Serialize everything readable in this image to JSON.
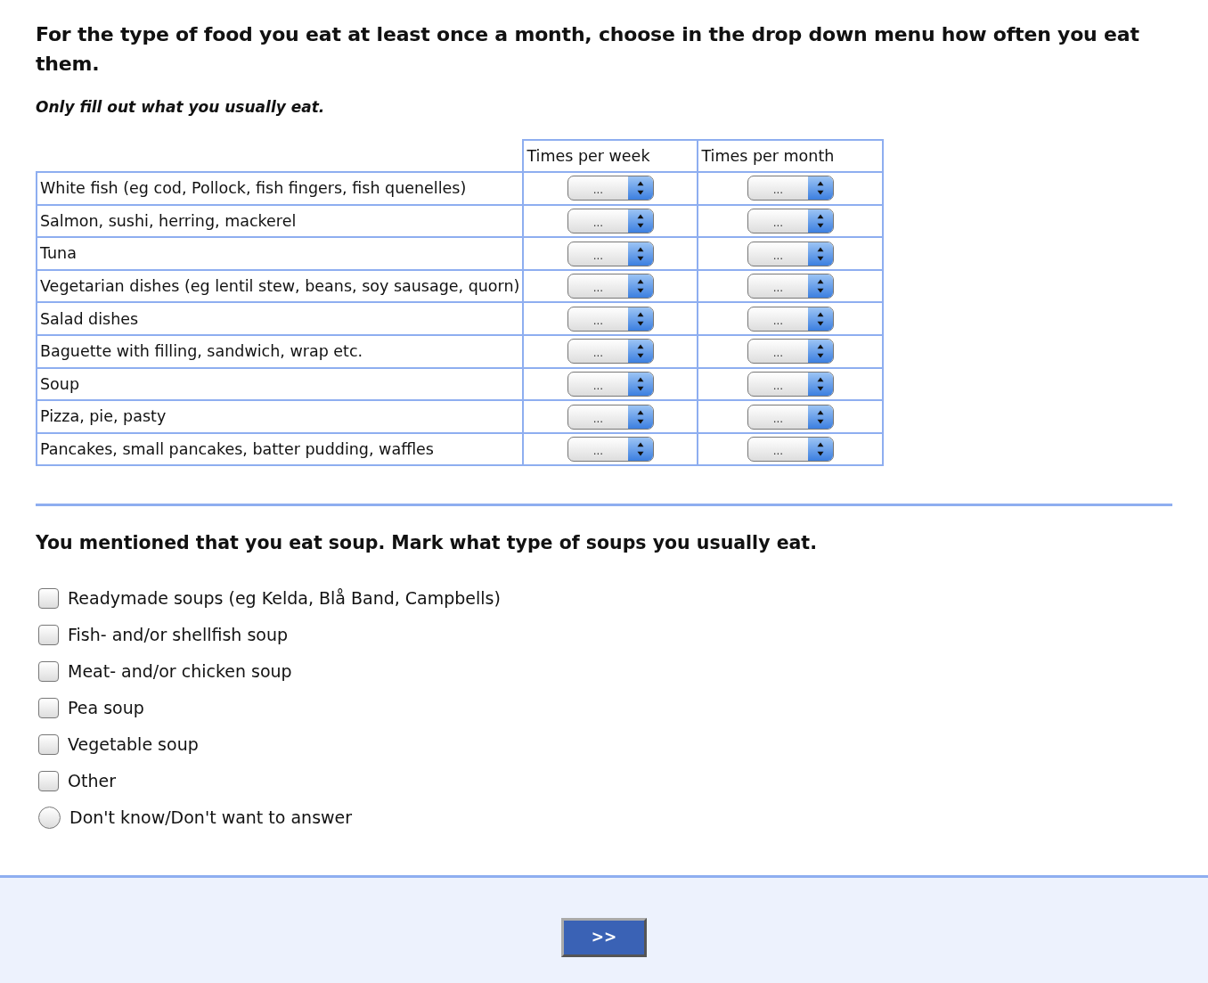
{
  "heading": "For the type of food you eat at least once a month, choose in the drop down menu how often you eat them.",
  "note": "Only fill out what you usually eat.",
  "table": {
    "columns": [
      "Times per week",
      "Times per month"
    ],
    "rows": [
      {
        "food": "White fish (eg cod, Pollock, fish fingers, fish quenelles)",
        "week": "...",
        "month": "..."
      },
      {
        "food": "Salmon, sushi, herring, mackerel",
        "week": "...",
        "month": "..."
      },
      {
        "food": "Tuna",
        "week": "...",
        "month": "..."
      },
      {
        "food": "Vegetarian dishes (eg lentil stew, beans, soy sausage, quorn)",
        "week": "...",
        "month": "..."
      },
      {
        "food": "Salad dishes",
        "week": "...",
        "month": "..."
      },
      {
        "food": "Baguette with filling, sandwich, wrap etc.",
        "week": "...",
        "month": "..."
      },
      {
        "food": "Soup",
        "week": "...",
        "month": "..."
      },
      {
        "food": "Pizza, pie, pasty",
        "week": "...",
        "month": "..."
      },
      {
        "food": "Pancakes, small pancakes, batter pudding, waffles",
        "week": "...",
        "month": "..."
      }
    ]
  },
  "question": "You mentioned that you eat soup. Mark what type of soups you usually eat.",
  "options": [
    {
      "kind": "checkbox",
      "label": "Readymade soups (eg Kelda, Blå Band, Campbells)",
      "checked": false
    },
    {
      "kind": "checkbox",
      "label": "Fish- and/or shellfish soup",
      "checked": false
    },
    {
      "kind": "checkbox",
      "label": "Meat- and/or chicken soup",
      "checked": false
    },
    {
      "kind": "checkbox",
      "label": "Pea soup",
      "checked": false
    },
    {
      "kind": "checkbox",
      "label": "Vegetable soup",
      "checked": false
    },
    {
      "kind": "checkbox",
      "label": "Other",
      "checked": false
    },
    {
      "kind": "radio",
      "label": "Don't know/Don't want to answer",
      "checked": false
    }
  ],
  "next_button": ">>"
}
